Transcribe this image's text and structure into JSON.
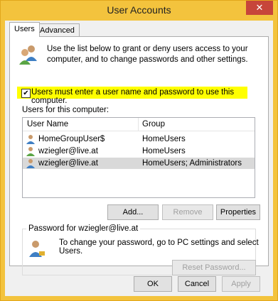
{
  "window": {
    "title": "User Accounts",
    "close_glyph": "✕"
  },
  "tabs": [
    {
      "label": "Users",
      "active": true
    },
    {
      "label": "Advanced",
      "active": false
    }
  ],
  "intro": {
    "icon": "users-group-icon",
    "text": "Use the list below to grant or deny users access to your computer, and to change passwords and other settings."
  },
  "require_login": {
    "checked": true,
    "label": "Users must enter a user name and password to use this computer."
  },
  "users_section": {
    "label": "Users for this computer:",
    "columns": [
      "User Name",
      "Group"
    ],
    "rows": [
      {
        "user": "HomeGroupUser$",
        "group": "HomeUsers",
        "icon": "user-icon",
        "selected": false
      },
      {
        "user": "wziegler@live.at",
        "group": "HomeUsers",
        "icon": "user-icon",
        "selected": false
      },
      {
        "user": "wziegler@live.at",
        "group": "HomeUsers; Administrators",
        "icon": "user-icon",
        "selected": true
      }
    ]
  },
  "list_buttons": {
    "add": "Add...",
    "remove": "Remove",
    "properties": "Properties"
  },
  "password_group": {
    "label": "Password for wziegler@live.at",
    "text": "To change your password, go to PC settings and select Users.",
    "reset_button": "Reset Password..."
  },
  "dialog_buttons": {
    "ok": "OK",
    "cancel": "Cancel",
    "apply": "Apply"
  },
  "colors": {
    "title_bar": "#f3c33d",
    "close_button": "#c7453a",
    "highlight": "#ffff00",
    "selected_row": "#d9d9d9"
  }
}
